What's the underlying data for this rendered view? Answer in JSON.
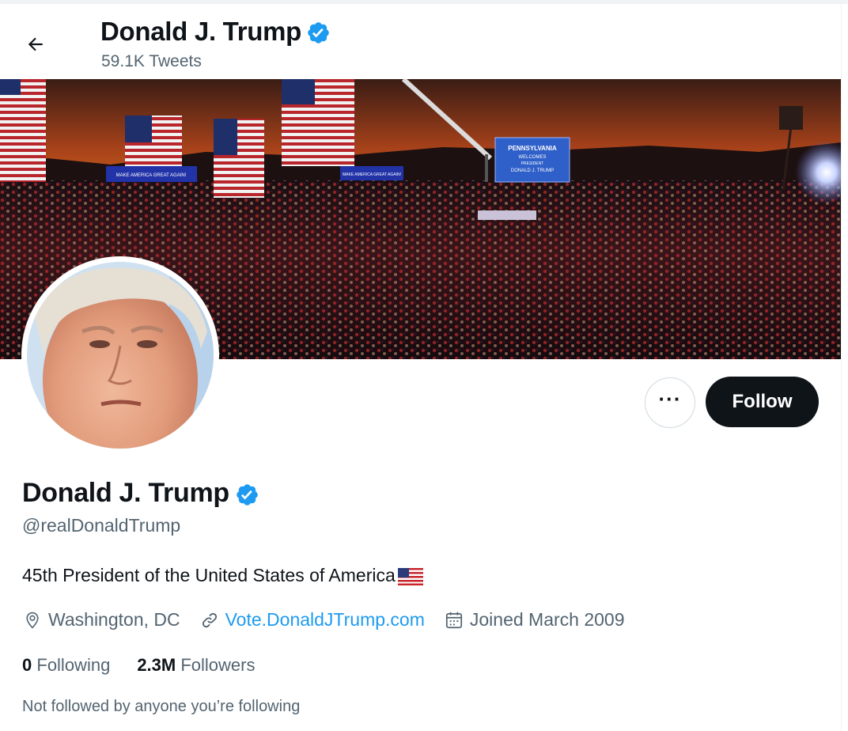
{
  "header": {
    "name": "Donald J. Trump",
    "tweet_count": "59.1K Tweets"
  },
  "banner": {
    "sign_1": "MAKE AMERICA GREAT AGAIN!",
    "sign_2": "MAKE AMERICA GREAT AGAIN!",
    "screen_line_1": "PENNSYLVANIA",
    "screen_line_2": "WELCOMES",
    "screen_line_3": "PRESIDENT",
    "screen_line_4": "DONALD J. TRUMP"
  },
  "actions": {
    "more_label": "···",
    "follow_label": "Follow"
  },
  "profile": {
    "name": "Donald J. Trump",
    "handle": "@realDonaldTrump",
    "bio": "45th President of the United States of America",
    "location": "Washington, DC",
    "website": "Vote.DonaldJTrump.com",
    "joined": "Joined March 2009",
    "following_count": "0",
    "following_label": "Following",
    "followers_count": "2.3M",
    "followers_label": "Followers",
    "not_followed_note": "Not followed by anyone you’re following"
  },
  "colors": {
    "verified_blue": "#1d9bf0",
    "link_blue": "#1d9bf0",
    "text_primary": "#0f1419",
    "text_secondary": "#536471",
    "follow_button_bg": "#0f1419"
  },
  "icons": [
    "back-arrow-icon",
    "verified-badge-icon",
    "more-icon",
    "location-icon",
    "link-icon",
    "calendar-icon",
    "us-flag-icon"
  ]
}
